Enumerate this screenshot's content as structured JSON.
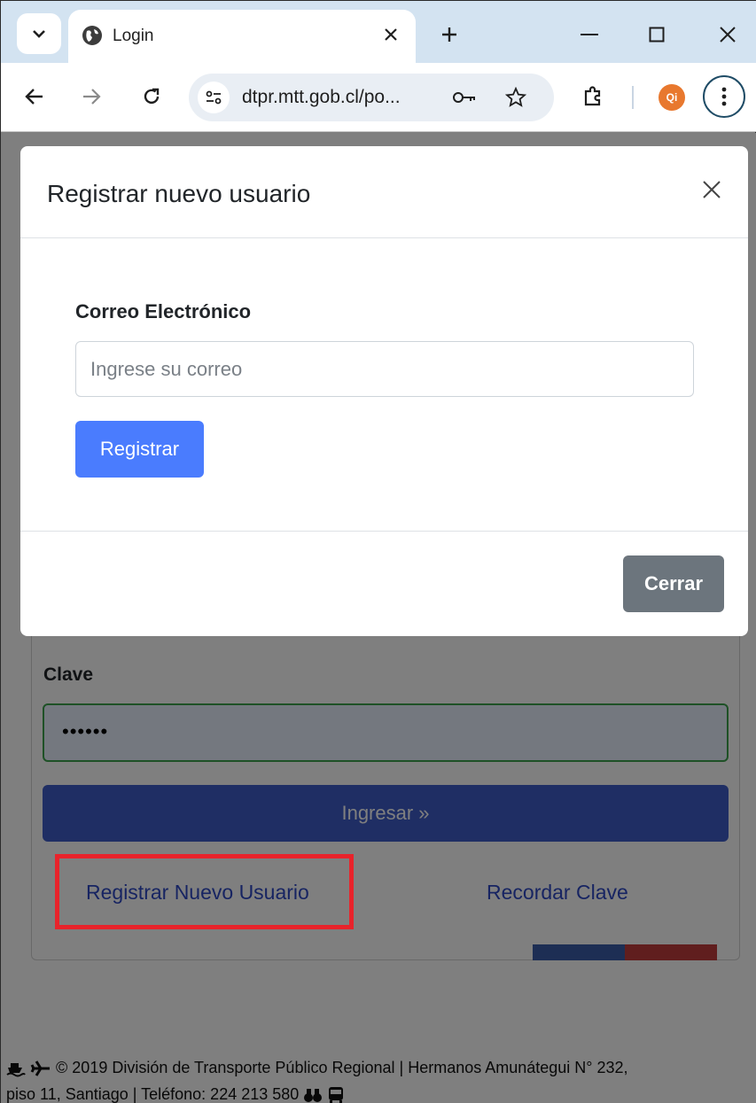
{
  "browser": {
    "tab_title": "Login",
    "url": "dtpr.mtt.gob.cl/po...",
    "profile_initials": "Qi"
  },
  "login_form": {
    "password_label": "Clave",
    "password_value": "••••••",
    "submit_label": "Ingresar »",
    "register_link": "Registrar Nuevo Usuario",
    "remember_link": "Recordar Clave"
  },
  "footer": {
    "line1": "© 2019 División de Transporte Público Regional | Hermanos Amunátegui N° 232,",
    "line2": "piso 11, Santiago | Teléfono: 224 213 580"
  },
  "modal": {
    "title": "Registrar nuevo usuario",
    "email_label": "Correo Electrónico",
    "email_placeholder": "Ingrese su correo",
    "email_value": "",
    "register_button": "Registrar",
    "close_button": "Cerrar"
  },
  "colors": {
    "primary_button": "#4a7cfe",
    "secondary_button": "#6c757d",
    "link": "#2e49c4",
    "highlight": "#e8232b"
  }
}
